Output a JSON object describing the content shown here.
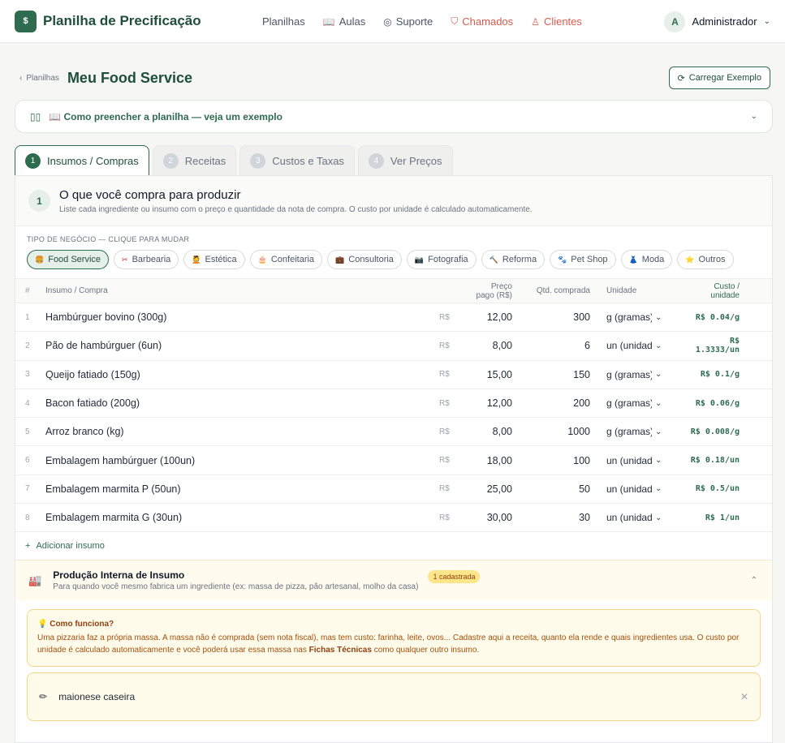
{
  "brand": {
    "logo": "$",
    "name": "Planilha de Precificação"
  },
  "nav": [
    {
      "label": "Planilhas",
      "icon": "",
      "red": false
    },
    {
      "label": "Aulas",
      "icon": "📖",
      "red": false
    },
    {
      "label": "Suporte",
      "icon": "◎",
      "red": false
    },
    {
      "label": "Chamados",
      "icon": "⛉",
      "red": true
    },
    {
      "label": "Clientes",
      "icon": "♙",
      "red": true
    }
  ],
  "user": {
    "initial": "A",
    "name": "Administrador"
  },
  "header": {
    "crumb": "Planilhas",
    "title": "Meu Food Service",
    "load_button": "Carregar Exemplo"
  },
  "howto": {
    "text": "📖 Como preencher a planilha — veja um exemplo"
  },
  "tabs": [
    {
      "num": "1",
      "label": "Insumos / Compras"
    },
    {
      "num": "2",
      "label": "Receitas"
    },
    {
      "num": "3",
      "label": "Custos e Taxas"
    },
    {
      "num": "4",
      "label": "Ver Preços"
    }
  ],
  "step": {
    "num": "1",
    "title": "O que você compra para produzir",
    "subtitle": "Liste cada ingrediente ou insumo com o preço e quantidade da nota de compra. O custo por unidade é calculado automaticamente."
  },
  "business": {
    "label": "TIPO DE NEGÓCIO — CLIQUE PARA MUDAR",
    "chips": [
      {
        "emoji": "🍔",
        "label": "Food Service"
      },
      {
        "emoji": "✂",
        "label": "Barbearia"
      },
      {
        "emoji": "💆",
        "label": "Estética"
      },
      {
        "emoji": "🎂",
        "label": "Confeitaria"
      },
      {
        "emoji": "💼",
        "label": "Consultoria"
      },
      {
        "emoji": "📷",
        "label": "Fotografia"
      },
      {
        "emoji": "🔨",
        "label": "Reforma"
      },
      {
        "emoji": "🐾",
        "label": "Pet Shop"
      },
      {
        "emoji": "👗",
        "label": "Moda"
      },
      {
        "emoji": "⭐",
        "label": "Outros"
      }
    ]
  },
  "table": {
    "headers": {
      "num": "#",
      "name": "Insumo / Compra",
      "price": "Preço pago (R$)",
      "qty": "Qtd. comprada",
      "unit": "Unidade",
      "cost": "Custo / unidade"
    },
    "currency": "R$",
    "rows": [
      {
        "num": "1",
        "name": "Hambúrguer bovino (300g)",
        "price": "12,00",
        "qty": "300",
        "unit": "g (gramas)",
        "cost": "R$ 0.04/g"
      },
      {
        "num": "2",
        "name": "Pão de hambúrguer (6un)",
        "price": "8,00",
        "qty": "6",
        "unit": "un (unidade)",
        "cost": "R$ 1.3333/un"
      },
      {
        "num": "3",
        "name": "Queijo fatiado (150g)",
        "price": "15,00",
        "qty": "150",
        "unit": "g (gramas)",
        "cost": "R$ 0.1/g"
      },
      {
        "num": "4",
        "name": "Bacon fatiado (200g)",
        "price": "12,00",
        "qty": "200",
        "unit": "g (gramas)",
        "cost": "R$ 0.06/g"
      },
      {
        "num": "5",
        "name": "Arroz branco (kg)",
        "price": "8,00",
        "qty": "1000",
        "unit": "g (gramas)",
        "cost": "R$ 0.008/g"
      },
      {
        "num": "6",
        "name": "Embalagem hambúrguer (100un)",
        "price": "18,00",
        "qty": "100",
        "unit": "un (unidade)",
        "cost": "R$ 0.18/un"
      },
      {
        "num": "7",
        "name": "Embalagem marmita P (50un)",
        "price": "25,00",
        "qty": "50",
        "unit": "un (unidade)",
        "cost": "R$ 0.5/un"
      },
      {
        "num": "8",
        "name": "Embalagem marmita G (30un)",
        "price": "30,00",
        "qty": "30",
        "unit": "un (unidade)",
        "cost": "R$ 1/un"
      }
    ],
    "add_label": "Adicionar insumo"
  },
  "production": {
    "title": "Produção Interna de Insumo",
    "subtitle": "Para quando você mesmo fabrica um ingrediente (ex: massa de pizza, pão artesanal, molho da casa)",
    "badge": "1 cadastrada",
    "info_title": "💡 Como funciona?",
    "info_text_1": "Uma pizzaria faz a própria massa. A massa não é comprada (sem nota fiscal), mas tem custo: farinha, leite, ovos... Cadastre aqui a receita, quanto ela rende e quais ingredientes usa. O custo por unidade é calculado automaticamente e você poderá usar essa massa nas ",
    "info_bold": "Fichas Técnicas",
    "info_text_2": " como qualquer outro insumo.",
    "recipe_name": "maionese caseira"
  },
  "colors": {
    "primary": "#2e6b4f",
    "accent_red": "#d85b4c",
    "amber_bg": "#fffbeb"
  }
}
